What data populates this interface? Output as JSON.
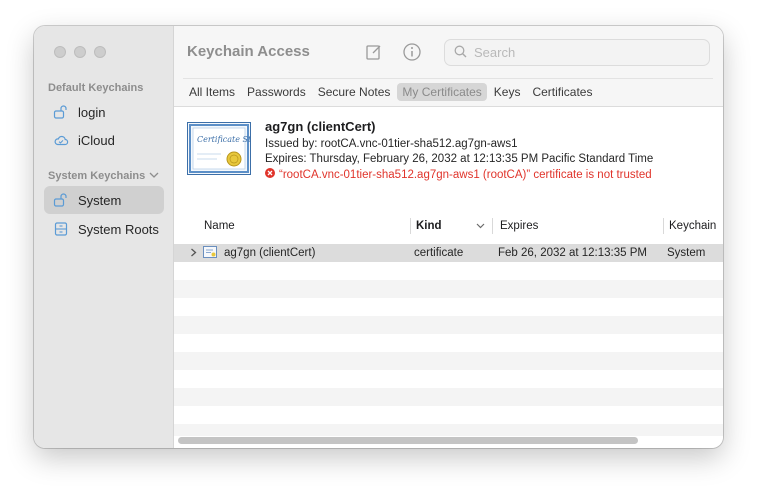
{
  "window": {
    "title": "Keychain Access"
  },
  "sidebar": {
    "sections": [
      {
        "label": "Default Keychains",
        "items": [
          {
            "label": "login",
            "icon": "lock-open-icon",
            "selected": false
          },
          {
            "label": "iCloud",
            "icon": "cloud-icon",
            "selected": false
          }
        ]
      },
      {
        "label": "System Keychains",
        "items": [
          {
            "label": "System",
            "icon": "lock-open-icon",
            "selected": true
          },
          {
            "label": "System Roots",
            "icon": "cabinet-icon",
            "selected": false
          }
        ]
      }
    ]
  },
  "toolbar": {
    "compose_icon": "compose-icon",
    "info_icon": "info-icon"
  },
  "search": {
    "placeholder": "Search",
    "value": ""
  },
  "tabs": [
    {
      "label": "All Items",
      "active": false
    },
    {
      "label": "Passwords",
      "active": false
    },
    {
      "label": "Secure Notes",
      "active": false
    },
    {
      "label": "My Certificates",
      "active": true
    },
    {
      "label": "Keys",
      "active": false
    },
    {
      "label": "Certificates",
      "active": false
    }
  ],
  "detail": {
    "title": "ag7gn (clientCert)",
    "issued_by": "Issued by: rootCA.vnc-01tier-sha512.ag7gn-aws1",
    "expires": "Expires: Thursday, February 26, 2032 at 12:13:35 PM Pacific Standard Time",
    "error": "“rootCA.vnc-01tier-sha512.ag7gn-aws1 (rootCA)” certificate is not trusted",
    "error_color": "#e0342b",
    "cert_image_text": "Certificate Standard"
  },
  "table": {
    "columns": {
      "name": "Name",
      "kind": "Kind",
      "expires": "Expires",
      "keychain": "Keychain"
    },
    "rows": [
      {
        "name": "ag7gn (clientCert)",
        "kind": "certificate",
        "expires": "Feb 26, 2032 at 12:13:35 PM",
        "keychain": "System",
        "selected": true
      }
    ]
  },
  "colors": {
    "sidebar_bg": "#e6e6e6",
    "selection_bg": "#d0d0d0",
    "row_alt": "#f4f4f4"
  }
}
